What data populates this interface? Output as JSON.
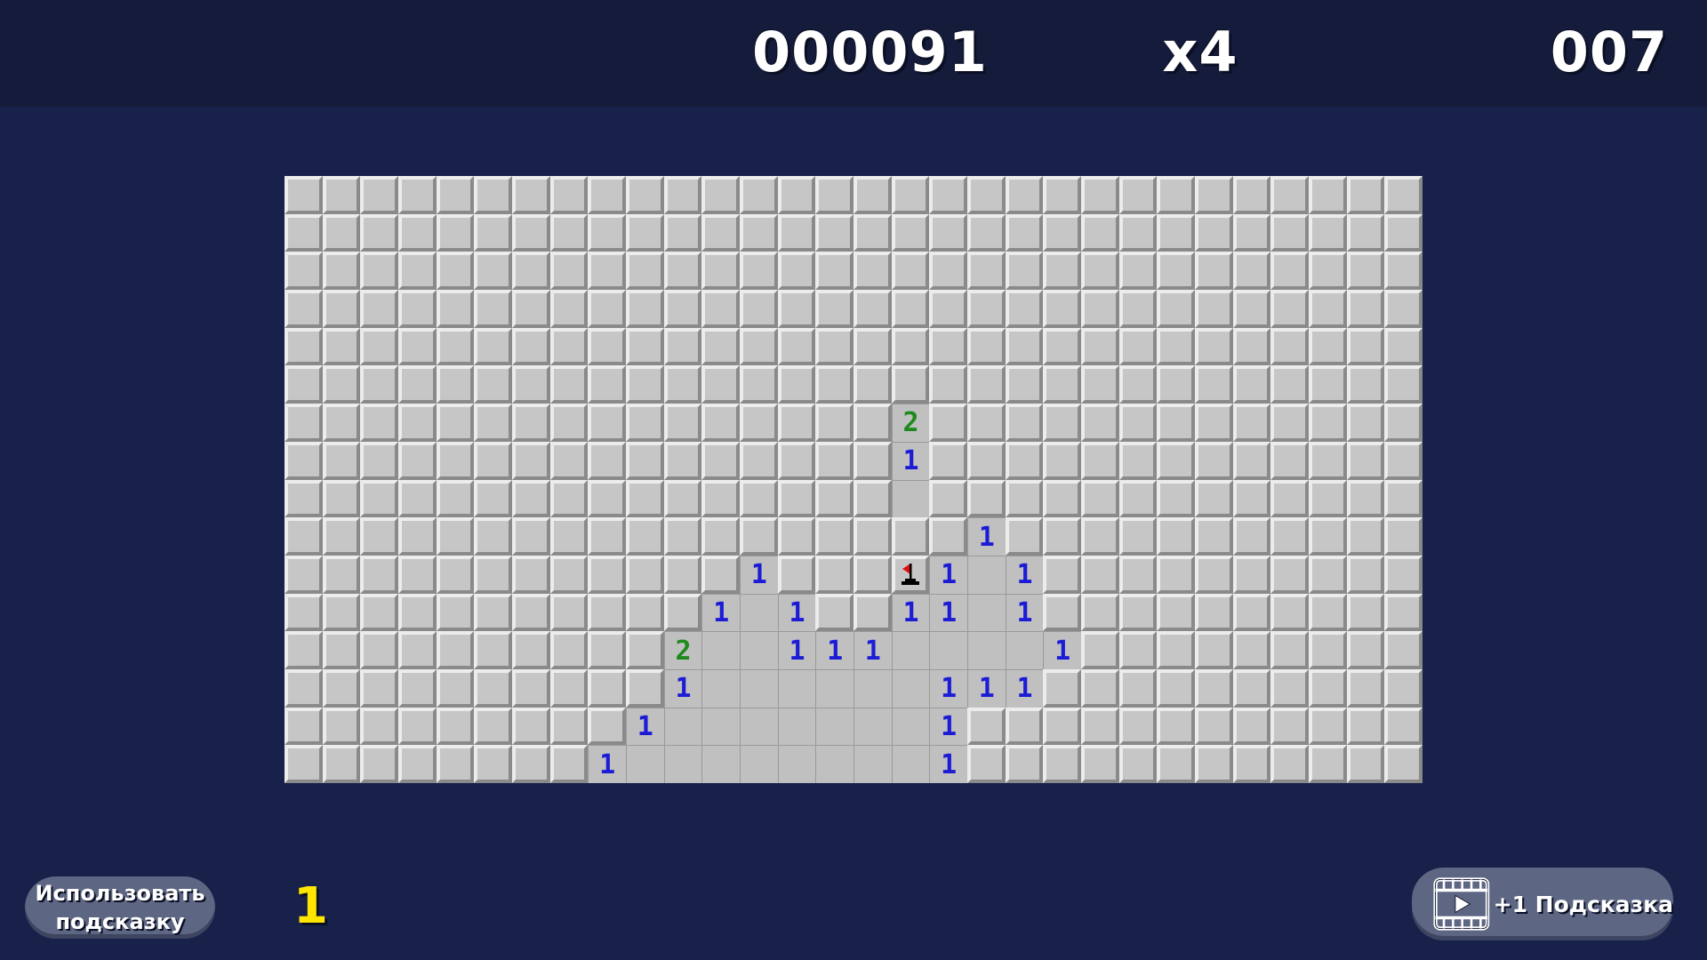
{
  "hud": {
    "score": "000091",
    "multiplier": "x4",
    "timer": "007"
  },
  "board": {
    "cols": 30,
    "rows": 16,
    "number_colors": {
      "1": "#1c1cd6",
      "2": "#1e8a1e"
    },
    "opened": [
      [
        6,
        16,
        "2"
      ],
      [
        7,
        16,
        "1"
      ],
      [
        8,
        16,
        ""
      ],
      [
        9,
        18,
        "1"
      ],
      [
        10,
        12,
        "1"
      ],
      [
        10,
        16,
        "F"
      ],
      [
        10,
        17,
        "1"
      ],
      [
        10,
        18,
        ""
      ],
      [
        10,
        19,
        "1"
      ],
      [
        11,
        11,
        "1"
      ],
      [
        11,
        12,
        ""
      ],
      [
        11,
        13,
        "1"
      ],
      [
        11,
        16,
        "1"
      ],
      [
        11,
        17,
        "1"
      ],
      [
        11,
        18,
        ""
      ],
      [
        11,
        19,
        "1"
      ],
      [
        12,
        10,
        "2"
      ],
      [
        12,
        11,
        ""
      ],
      [
        12,
        12,
        ""
      ],
      [
        12,
        13,
        "1"
      ],
      [
        12,
        14,
        "1"
      ],
      [
        12,
        15,
        "1"
      ],
      [
        12,
        16,
        ""
      ],
      [
        12,
        17,
        ""
      ],
      [
        12,
        18,
        ""
      ],
      [
        12,
        19,
        ""
      ],
      [
        12,
        20,
        "1"
      ],
      [
        13,
        10,
        "1"
      ],
      [
        13,
        11,
        ""
      ],
      [
        13,
        12,
        ""
      ],
      [
        13,
        13,
        ""
      ],
      [
        13,
        14,
        ""
      ],
      [
        13,
        15,
        ""
      ],
      [
        13,
        16,
        ""
      ],
      [
        13,
        17,
        "1"
      ],
      [
        13,
        18,
        "1"
      ],
      [
        13,
        19,
        "1"
      ],
      [
        14,
        9,
        "1"
      ],
      [
        14,
        10,
        ""
      ],
      [
        14,
        11,
        ""
      ],
      [
        14,
        12,
        ""
      ],
      [
        14,
        13,
        ""
      ],
      [
        14,
        14,
        ""
      ],
      [
        14,
        15,
        ""
      ],
      [
        14,
        16,
        ""
      ],
      [
        14,
        17,
        "1"
      ],
      [
        15,
        8,
        "1"
      ],
      [
        15,
        9,
        ""
      ],
      [
        15,
        10,
        ""
      ],
      [
        15,
        11,
        ""
      ],
      [
        15,
        12,
        ""
      ],
      [
        15,
        13,
        ""
      ],
      [
        15,
        14,
        ""
      ],
      [
        15,
        15,
        ""
      ],
      [
        15,
        16,
        ""
      ],
      [
        15,
        17,
        "1"
      ]
    ]
  },
  "hint": {
    "label": "Использовать подсказку",
    "count": "1"
  },
  "video": {
    "label": "+1 Подсказка",
    "icon": "video-play-icon"
  }
}
